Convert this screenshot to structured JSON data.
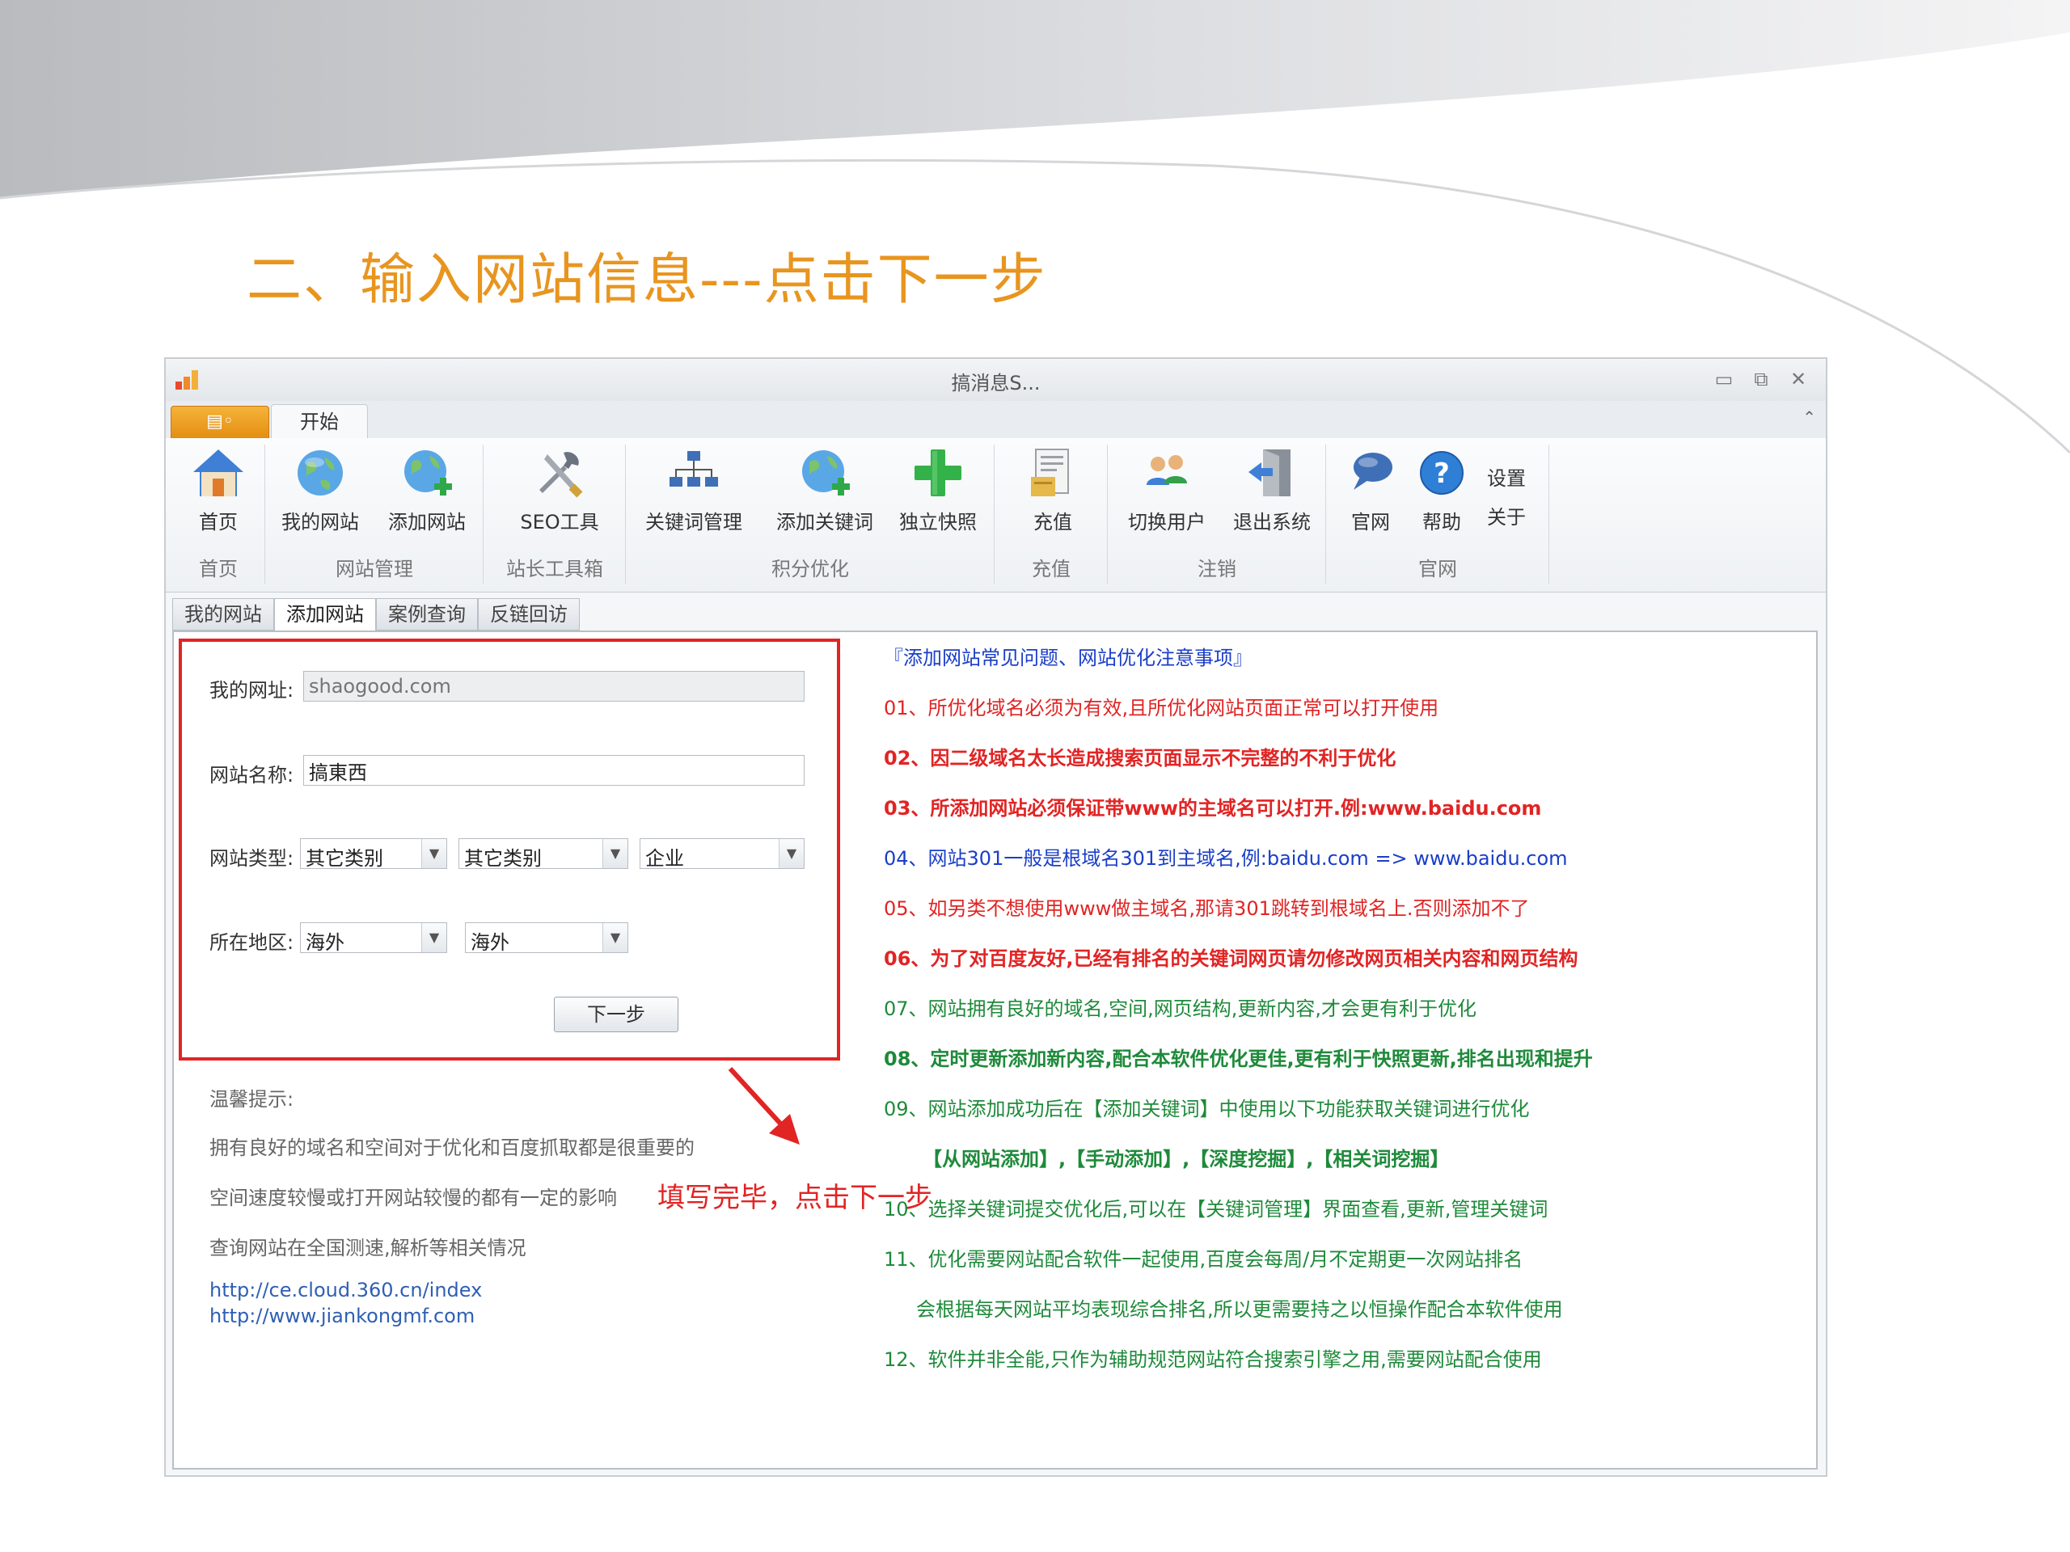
{
  "slide": {
    "title": "二、输入网站信息---点击下一步",
    "title_color": "#e8951f"
  },
  "window": {
    "title": "搞消息S...",
    "controls": {
      "minimize": "▭",
      "restore": "⧉",
      "close": "✕"
    }
  },
  "ribbon": {
    "app_menu_label": "▤◦",
    "tab_label": "开始",
    "buttons": {
      "home": "首页",
      "my_site": "我的网站",
      "add_site": "添加网站",
      "seo_tools": "SEO工具",
      "keyword_mgmt": "关键词管理",
      "add_keyword": "添加关键词",
      "snapshot": "独立快照",
      "recharge": "充值",
      "switch_user": "切换用户",
      "exit": "退出系统",
      "official": "官网",
      "help": "帮助",
      "settings": "设置",
      "about": "关于"
    },
    "groups": {
      "home": "首页",
      "site_mgmt": "网站管理",
      "webmaster": "站长工具箱",
      "points": "积分优化",
      "recharge": "充值",
      "logout": "注销",
      "official": "官网"
    }
  },
  "doc_tabs": [
    "我的网站",
    "添加网站",
    "案例查询",
    "反链回访"
  ],
  "form": {
    "url_label": "我的网址:",
    "url_placeholder": "shaogood.com",
    "name_label": "网站名称:",
    "name_value": "搞東西",
    "type_label": "网站类型:",
    "type_1": "其它类别",
    "type_2": "其它类别",
    "type_3": "企业",
    "region_label": "所在地区:",
    "region_1": "海外",
    "region_2": "海外",
    "next_button": "下一步"
  },
  "tips": {
    "heading": "温馨提示:",
    "line1": "拥有良好的域名和空间对于优化和百度抓取都是很重要的",
    "line2": "空间速度较慢或打开网站较慢的都有一定的影响",
    "line3": "查询网站在全国测速,解析等相关情况",
    "link1": "http://ce.cloud.360.cn/index",
    "link2": "http://www.jiankongmf.com"
  },
  "annotation": "填写完毕，点击下一步",
  "notes": {
    "title": "『添加网站常见问题、网站优化注意事项』",
    "n01": "01、所优化域名必须为有效,且所优化网站页面正常可以打开使用",
    "n02": "02、因二级域名太长造成搜索页面显示不完整的不利于优化",
    "n03": "03、所添加网站必须保证带www的主域名可以打开.例:www.baidu.com",
    "n04": "04、网站301一般是根域名301到主域名,例:baidu.com => www.baidu.com",
    "n05": "05、如另类不想使用www做主域名,那请301跳转到根域名上.否则添加不了",
    "n06": "06、为了对百度友好,已经有排名的关键词网页请勿修改网页相关内容和网页结构",
    "n07": "07、网站拥有良好的域名,空间,网页结构,更新内容,才会更有利于优化",
    "n08": "08、定时更新添加新内容,配合本软件优化更佳,更有利于快照更新,排名出现和提升",
    "n09": "09、网站添加成功后在【添加关键词】中使用以下功能获取关键词进行优化",
    "n09b": "【从网站添加】,【手动添加】,【深度挖掘】,【相关词挖掘】",
    "n10": "10、选择关键词提交优化后,可以在【关键词管理】界面查看,更新,管理关键词",
    "n11": "11、优化需要网站配合软件一起使用,百度会每周/月不定期更一次网站排名",
    "n11b": "会根据每天网站平均表现综合排名,所以更需要持之以恒操作配合本软件使用",
    "n12": "12、软件并非全能,只作为辅助规范网站符合搜索引擎之用,需要网站配合使用"
  },
  "colors": {
    "note_title": "#1a3ec8",
    "note_red": "#e12424",
    "note_green": "#1e8a3a",
    "highlight_border": "#e12424",
    "link": "#2f5fb3"
  },
  "icons": [
    "home-icon",
    "globe-icon",
    "globe-add-icon",
    "tools-icon",
    "sitemap-icon",
    "globe-add-icon",
    "plus-icon",
    "document-icon",
    "users-icon",
    "exit-door-icon",
    "chat-bubble-icon",
    "help-icon"
  ]
}
